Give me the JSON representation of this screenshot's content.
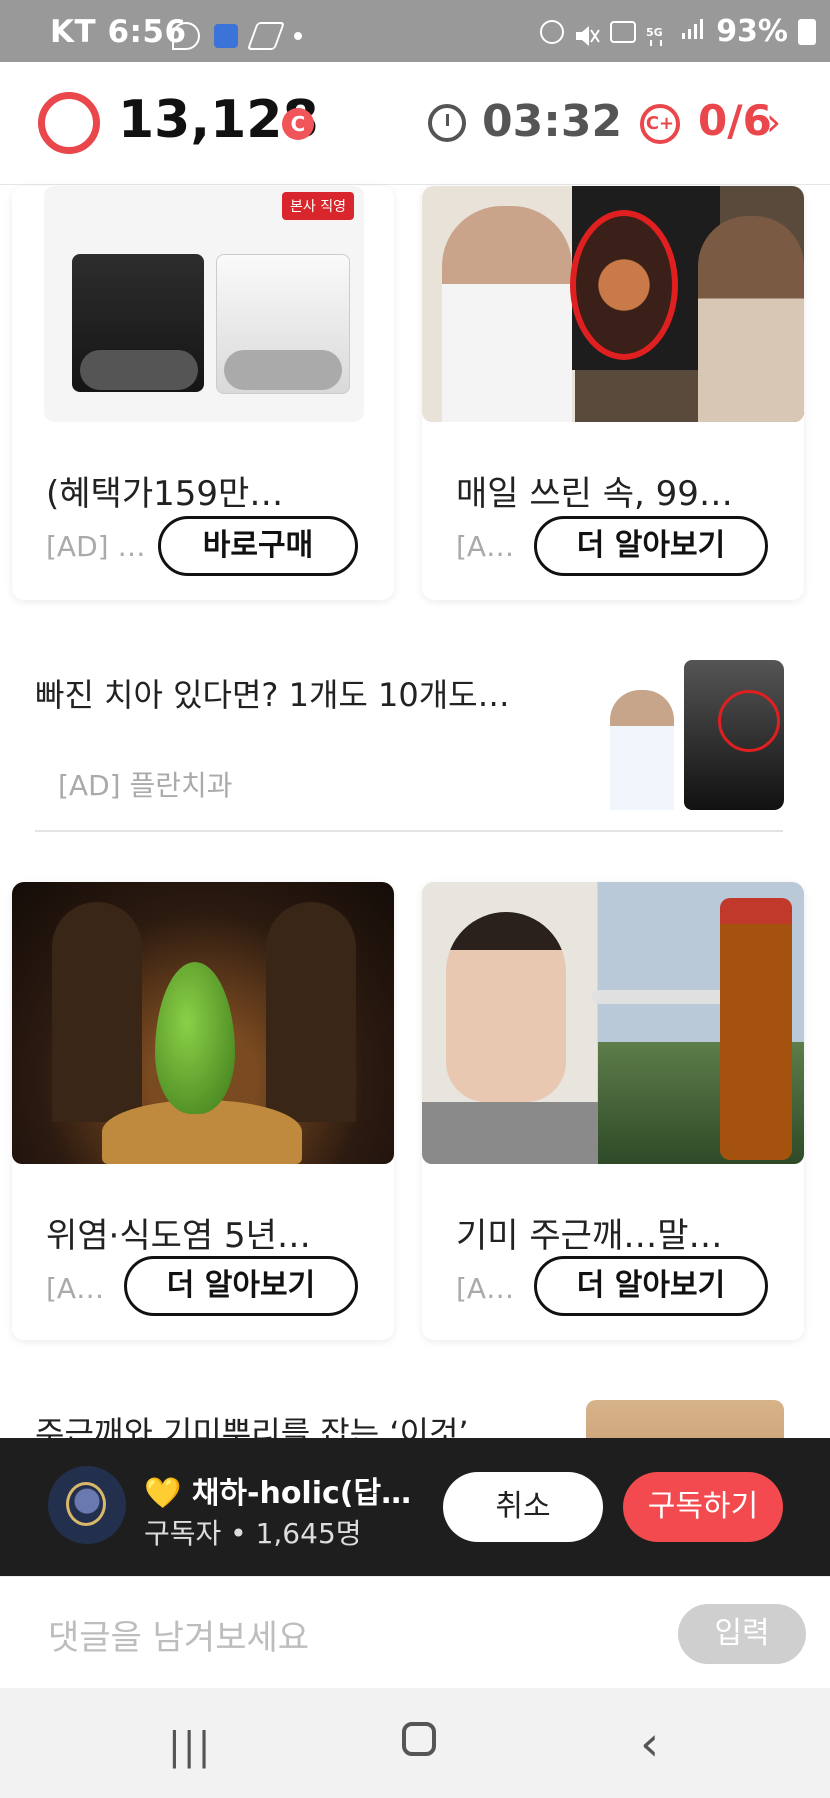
{
  "status_bar": {
    "carrier": "KT",
    "time": "6:56",
    "battery": "93%",
    "icons": [
      "mention-icon",
      "app-badge-icon",
      "pen-icon",
      "dot-icon",
      "alarm-icon",
      "mute-icon",
      "hd-icon",
      "5g-icon",
      "signal-icon",
      "battery-icon"
    ]
  },
  "header": {
    "points": "13,128",
    "coin_label": "C",
    "timer": "03:32",
    "mission_progress": "0/6",
    "accent_color": "#e9474c"
  },
  "feed": {
    "cards_row1": [
      {
        "title": "(혜택가159만…",
        "ad_label": "[AD] …",
        "button": "바로구매",
        "image_badge": "본사 직영"
      },
      {
        "title": "매일 쓰린 속, 99…",
        "ad_label": "[A…",
        "button": "더 알아보기"
      }
    ],
    "list_ad": {
      "title": "빠진 치아 있다면? 1개도 10개도…",
      "ad_label": "[AD] 플란치과"
    },
    "cards_row2": [
      {
        "title": "위염·식도염 5년…",
        "ad_label": "[A…",
        "button": "더 알아보기"
      },
      {
        "title": "기미 주근깨…말…",
        "ad_label": "[A…",
        "button": "더 알아보기"
      }
    ],
    "partial_title": "주근깨와 기미뿌리를 잡는 ‘이것’…"
  },
  "subscribe_overlay": {
    "channel_name": "채하-holic(답…",
    "heart": "💛",
    "subscribers": "구독자 • 1,645명",
    "cancel_label": "취소",
    "subscribe_label": "구독하기"
  },
  "comment": {
    "placeholder": "댓글을 남겨보세요",
    "submit_label": "입력"
  },
  "navigation": {
    "recent_glyph": "|||",
    "back_glyph": "‹"
  }
}
